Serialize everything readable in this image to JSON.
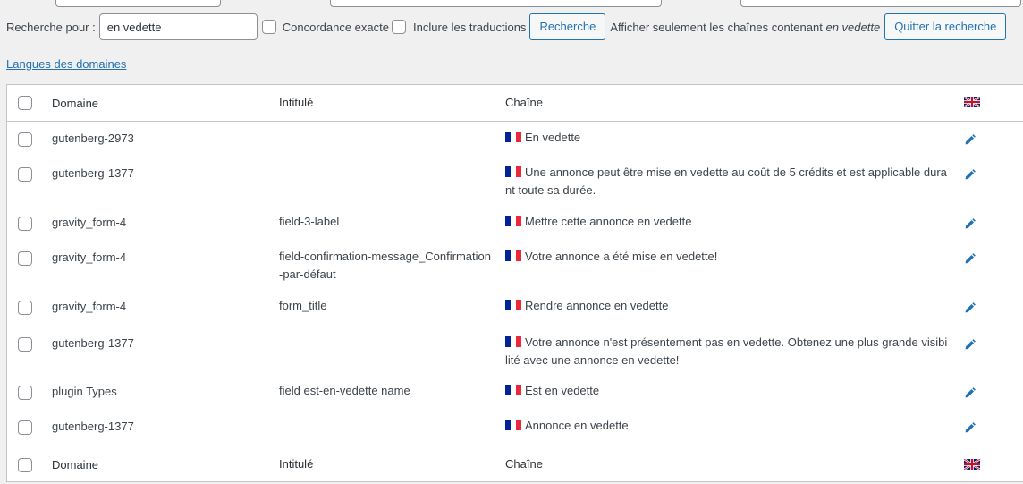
{
  "search": {
    "label": "Recherche pour :",
    "value": "en vedette",
    "exact_label": "Concordance exacte",
    "translations_label": "Inclure les traductions",
    "search_button": "Recherche",
    "notice_prefix": "Afficher seulement les chaînes contenant",
    "notice_term": "en vedette",
    "quit_button": "Quitter la recherche"
  },
  "domains_link": "Langues des domaines",
  "table": {
    "columns": {
      "domain": "Domaine",
      "label": "Intitulé",
      "string": "Chaîne"
    },
    "rows": [
      {
        "domain": "gutenberg-2973",
        "label": "",
        "string": "En vedette"
      },
      {
        "domain": "gutenberg-1377",
        "label": "",
        "string": "Une annonce peut être mise en vedette au coût de 5 crédits et est applicable durant toute sa durée."
      },
      {
        "domain": "gravity_form-4",
        "label": "field-3-label",
        "string": "Mettre cette annonce en vedette"
      },
      {
        "domain": "gravity_form-4",
        "label": "field-confirmation-message_Confirmation-par-défaut",
        "string": "Votre annonce a été mise en vedette!"
      },
      {
        "domain": "gravity_form-4",
        "label": "form_title",
        "string": "Rendre annonce en vedette"
      },
      {
        "domain": "gutenberg-1377",
        "label": "",
        "string": "Votre annonce n'est présentement pas en vedette. Obtenez une plus grande visibilité avec une annonce en vedette!"
      },
      {
        "domain": "plugin Types",
        "label": "field est-en-vedette name",
        "string": "Est en vedette"
      },
      {
        "domain": "gutenberg-1377",
        "label": "",
        "string": "Annonce en vedette"
      }
    ]
  },
  "icons": {
    "lang_header": "uk-flag-icon",
    "row_lang": "fr-flag-icon",
    "edit": "pencil-icon"
  },
  "colors": {
    "accent": "#2271b1",
    "background": "#f0f0f1",
    "border": "#c3c4c7"
  }
}
